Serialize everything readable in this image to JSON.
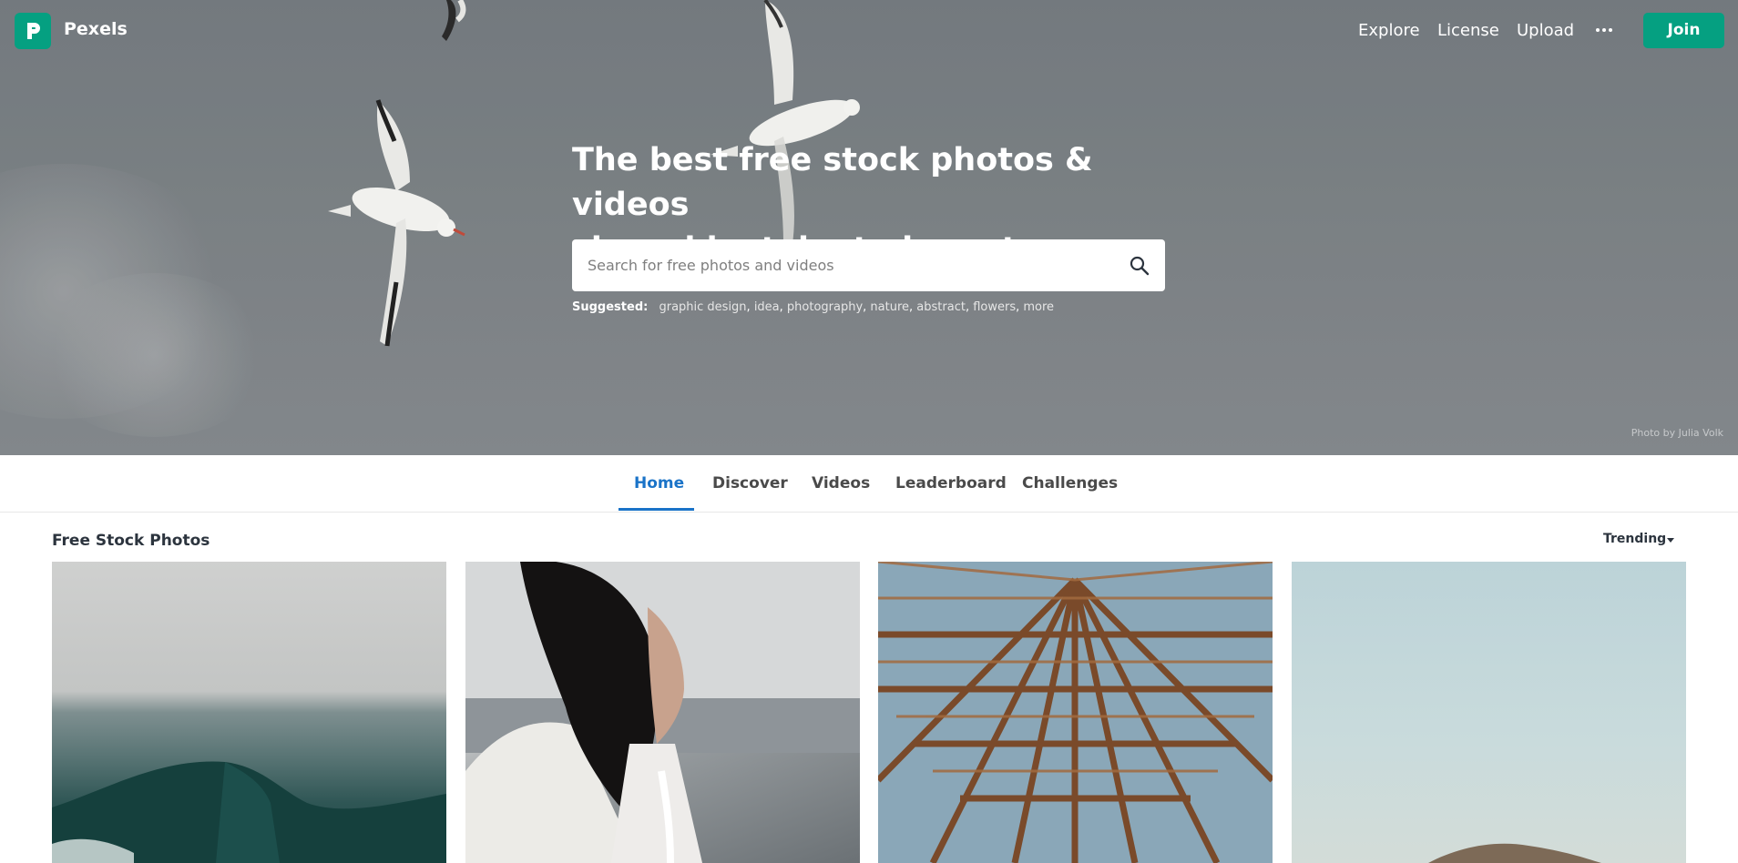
{
  "header": {
    "brand": "Pexels",
    "logo_icon": "pexels-logo-icon",
    "nav": [
      "Explore",
      "License",
      "Upload"
    ],
    "more_icon": "more-dots-icon",
    "join_label": "Join"
  },
  "hero": {
    "headline_line1": "The best free stock photos & videos",
    "headline_line2": "shared by talented creators.",
    "search_placeholder": "Search for free photos and videos",
    "search_icon": "search-icon",
    "suggested_label": "Suggested:",
    "suggested_tags": [
      "graphic design",
      "idea",
      "photography",
      "nature",
      "abstract",
      "flowers",
      "more"
    ],
    "photo_credit": "Photo by Julia Volk"
  },
  "tabs": {
    "items": [
      "Home",
      "Discover",
      "Videos",
      "Leaderboard",
      "Challenges"
    ],
    "active": "Home"
  },
  "content": {
    "section_title": "Free Stock Photos",
    "sort_label": "Trending"
  },
  "colors": {
    "brand_green": "#05a081",
    "active_tab_blue": "#1a73c8",
    "text_dark": "#2c343e"
  }
}
